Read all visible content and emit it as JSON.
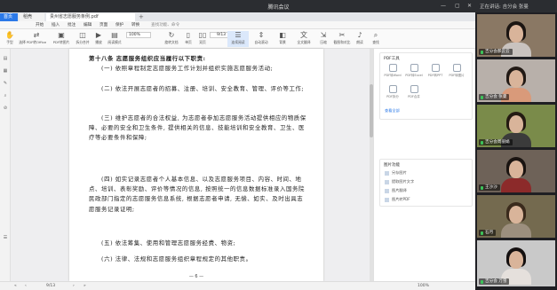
{
  "window": {
    "title": "腾讯会议",
    "speaking": "正在讲话: 吉分会 张曼"
  },
  "tabs": {
    "home": "首页",
    "doc": "稻壳",
    "pdf": "贵州省志愿服务条例.pdf",
    "new_tab": "+"
  },
  "menu": [
    "开始",
    "插入",
    "批注",
    "编辑",
    "页面",
    "保护",
    "转换",
    "查找功能、命令"
  ],
  "toolbar": {
    "left_tools": [
      "手型",
      "选择",
      "PDF转Office",
      "PDF转图片",
      "拆分合并",
      "播放",
      "阅读模式"
    ],
    "zoom": "100%",
    "page": "9/13",
    "right_tools": [
      "旋转文档",
      "单页",
      "双页",
      "连续阅读",
      "自动滚动",
      "背景",
      "全文翻译",
      "压缩",
      "截图和对比",
      "朗读",
      "查找"
    ]
  },
  "document": {
    "paragraphs": [
      "第十八条 志愿服务组织应当履行以下职责:",
      "(一) 依照章程制定志愿服务工作计划并组织实施志愿服务活动;",
      "(二) 依法开展志愿者的招募、注册、培训、安全教育、管理、评价等工作;",
      "(三) 维护志愿者的合法权益, 为志愿者参加志愿服务活动提供相应的物质保障、必要的安全和卫生条件, 提供相关的信息、技能培训和安全教育、卫生、医疗等必要条件和保障;",
      "(四) 如实记录志愿者个人基本信息、以及志愿服务项目、内容、时间、地点、培训、表彰奖励、评价等情况的信息, 按照统一的信息数据标准录入国务院民政部门指定的志愿服务信息系统, 根据志愿者申请, 无偿、如实、及时出具志愿服务记录证明;",
      "(五) 依法筹集、使用和管理志愿服务经费、物资;",
      "(六) 法律、法规和志愿服务组织章程规定的其他职责。"
    ],
    "page_number": "— 6 —"
  },
  "status": {
    "page": "9/13",
    "zoom": "100%"
  },
  "right_panel": {
    "tools_title": "PDF工具",
    "tools": [
      "PDF转Word",
      "PDF转Excel",
      "PDF转PPT",
      "PDF转图片",
      "PDF拆分",
      "PDF合并"
    ],
    "more_title": "查看全部",
    "actions_title": "图片功能",
    "actions": [
      "另存图片",
      "提取图片文字",
      "图片翻译",
      "图片转PDF"
    ]
  },
  "participants": [
    {
      "name": "吉分会郝云云",
      "muted": false,
      "bg": "#8a7864",
      "hair": "#1b1512",
      "shirt": "#c9c3bf"
    },
    {
      "name": "吉分会 张曼",
      "muted": false,
      "bg": "#b8b0aa",
      "hair": "#221a15",
      "shirt": "#d99a7a"
    },
    {
      "name": "吉分会周丽娟",
      "muted": false,
      "bg": "#7a8b4a",
      "hair": "#241a12",
      "shirt": "#3b3b3b"
    },
    {
      "name": "王沙沙",
      "muted": false,
      "bg": "#6e6258",
      "hair": "#1a1411",
      "shirt": "#8c2a2a"
    },
    {
      "name": "石月",
      "muted": false,
      "bg": "#746a4f",
      "hair": "#3a2a1c",
      "shirt": "#9c8f7e"
    },
    {
      "name": "吉分会 万雪",
      "muted": false,
      "bg": "#c9c9c9",
      "hair": "#141010",
      "shirt": "#e5e0dc"
    }
  ]
}
